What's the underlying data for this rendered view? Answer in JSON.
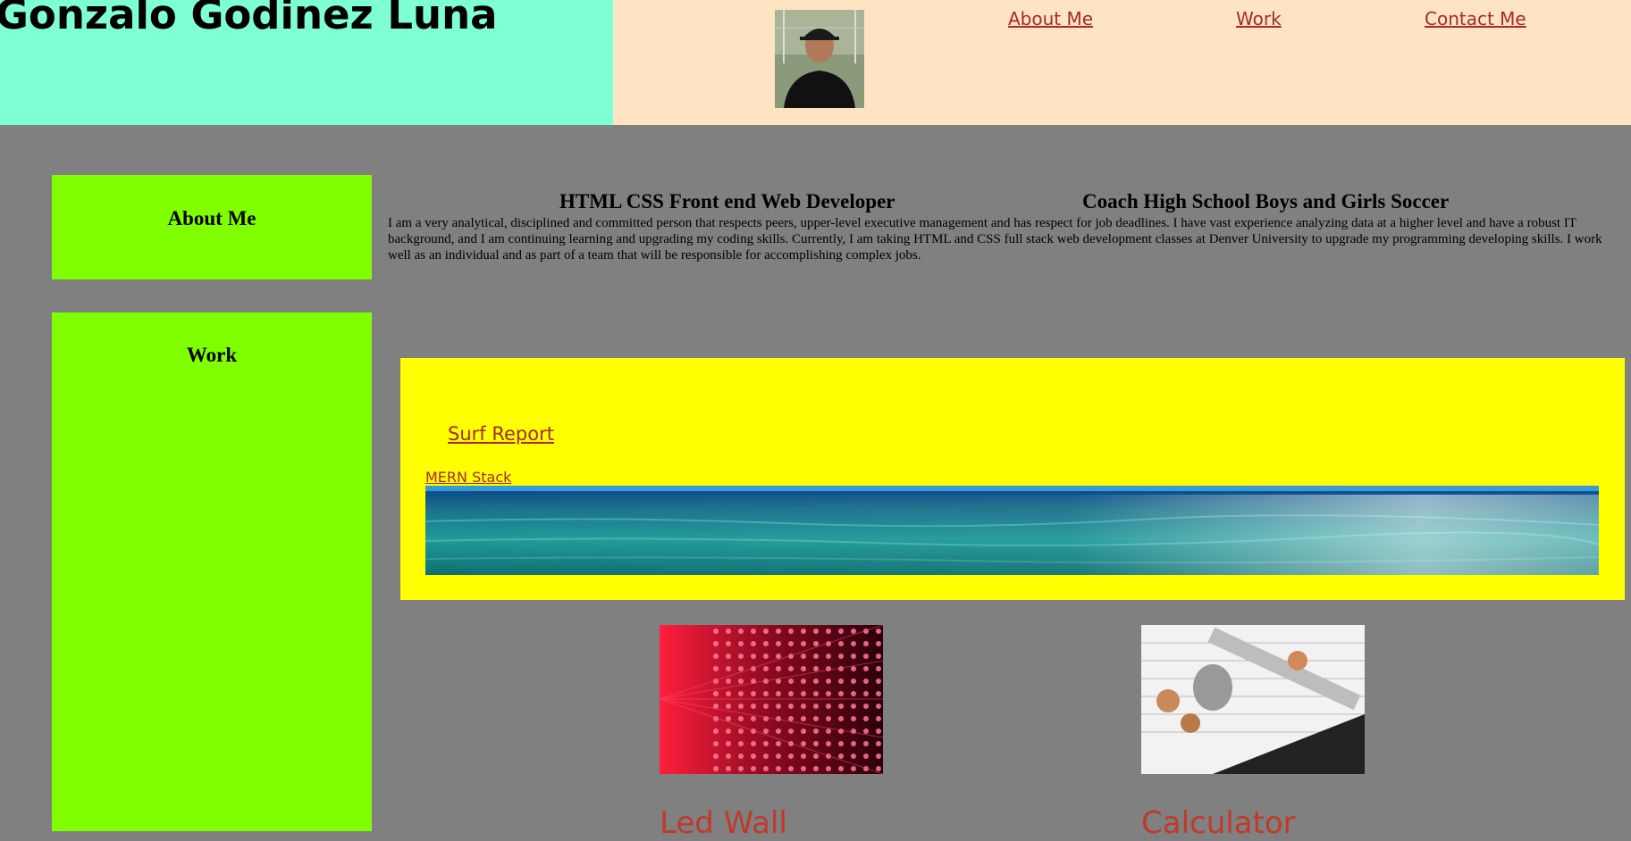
{
  "header": {
    "title": "Gonzalo Godinez Luna",
    "nav": [
      {
        "label": "About Me",
        "icon": "link"
      },
      {
        "label": "Work",
        "icon": "link"
      },
      {
        "label": "Contact Me",
        "icon": "link"
      }
    ],
    "avatar_icon": "avatar-photo"
  },
  "sidebar": {
    "about_label": "About Me",
    "work_label": "Work"
  },
  "about": {
    "heading_1": "HTML CSS Front end Web Developer",
    "heading_2": "Coach High School Boys and Girls Soccer",
    "bio": "I am a very analytical, disciplined and committed person that respects peers, upper-level executive management and has respect for job deadlines. I have vast experience analyzing data at a higher level and have a robust IT background, and I am continuing learning and upgrading my coding skills. Currently, I am taking HTML and CSS full stack web development classes at Denver University to upgrade my programming developing skills. I work well as an individual and as part of a team that will be responsible for accomplishing complex jobs."
  },
  "work": {
    "surf_report_label": "Surf Report",
    "mern_stack_label": "MERN Stack",
    "projects": [
      {
        "title": "Led Wall",
        "image_icon": "led-wall-image"
      },
      {
        "title": "Calculator",
        "image_icon": "calculator-image"
      }
    ]
  },
  "colors": {
    "page_background": "#808080",
    "header_left": "#7fffd4",
    "header_right": "#ffe4c4",
    "sidebar": "#7fff00",
    "work_panel": "#ffff00",
    "link": "#a52a2a"
  }
}
